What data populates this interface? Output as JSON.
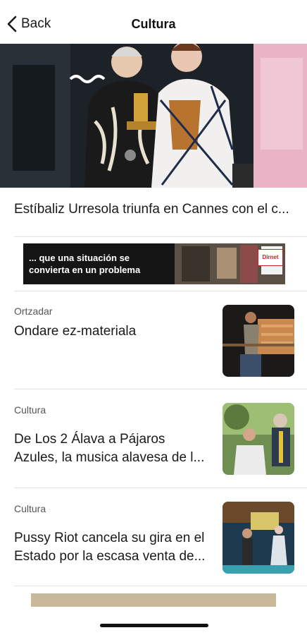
{
  "nav": {
    "back_label": "Back",
    "title": "Cultura",
    "back_icon": "chevron-left-icon"
  },
  "featured": {
    "caption": "Estíbaliz Urresola triunfa en Cannes con el c..."
  },
  "ad": {
    "text": "... que una situación se convierta en un problema",
    "logo_text": "Dirnet"
  },
  "articles": [
    {
      "category": "Ortzadar",
      "title": "Ondare ez-materiala"
    },
    {
      "category": "Cultura",
      "title": "De Los 2 Álava a Pájaros Azules, la musica alavesa de l..."
    },
    {
      "category": "Cultura",
      "title": "Pussy Riot cancela su gira en el Estado por la escasa venta de..."
    }
  ],
  "colors": {
    "separator": "#e4e4e4",
    "bottom_banner": "#c9b99a"
  }
}
